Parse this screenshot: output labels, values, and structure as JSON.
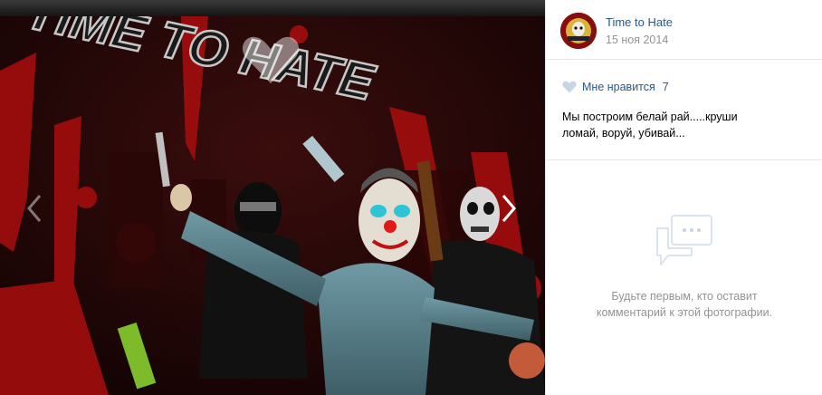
{
  "photo": {
    "poster_title": "TIME TO HATE"
  },
  "author": {
    "name": "Time to Hate",
    "date": "15 ноя 2014"
  },
  "likes": {
    "label": "Мне нравится",
    "count": "7"
  },
  "caption": {
    "line1": "Мы построим белай рай.....круши",
    "line2": "ломай, воруй, убивай..."
  },
  "comments": {
    "empty_line1": "Будьте первым, кто оставит",
    "empty_line2": "комментарий к этой фотографии."
  },
  "icons": {
    "prev": "chevron-left-icon",
    "next": "chevron-right-icon",
    "like": "heart-icon",
    "comment": "speech-bubble-icon"
  },
  "colors": {
    "link": "#2a5885",
    "muted": "#939393",
    "poster_red": "#b01010",
    "poster_bg": "#1a0606"
  }
}
